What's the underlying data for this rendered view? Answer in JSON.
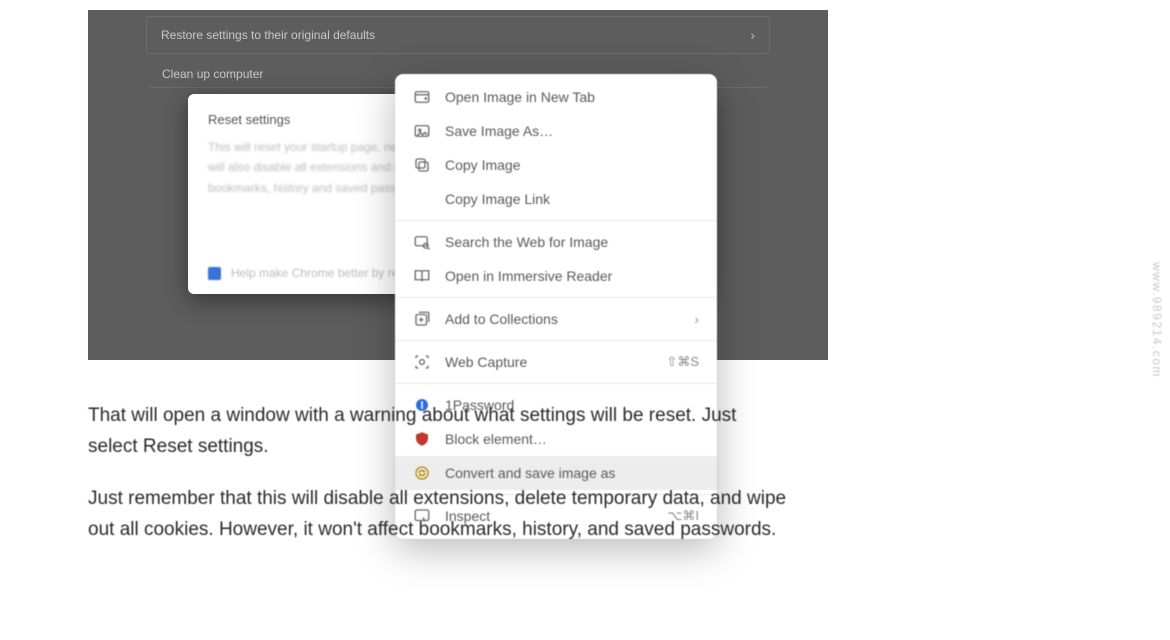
{
  "shot": {
    "row1": "Restore settings to their original defaults",
    "row2": "Clean up computer"
  },
  "dialog": {
    "title": "Reset settings",
    "body_l1": "This will reset your startup page, new tab",
    "body_l2": "will also disable all extensions and clear",
    "body_l3": "bookmarks, history and saved passwords",
    "footer": "Help make Chrome better by report"
  },
  "ctx": {
    "open_new_tab": "Open Image in New Tab",
    "save_as": "Save Image As…",
    "copy_image": "Copy Image",
    "copy_link": "Copy Image Link",
    "search_web": "Search the Web for Image",
    "immersive": "Open in Immersive Reader",
    "collections": "Add to Collections",
    "web_capture": "Web Capture",
    "web_capture_shortcut": "⇧⌘S",
    "onepassword": "1Password",
    "block_element": "Block element…",
    "convert_save": "Convert and save image as",
    "inspect": "Inspect",
    "inspect_shortcut": "⌥⌘I"
  },
  "article": {
    "p1": "That will open a window with a warning about what settings will be reset. Just select Reset settings.",
    "p2": "Just remember that this will disable all extensions, delete temporary data, and wipe out all cookies. However, it won't affect bookmarks, history, and saved passwords."
  },
  "watermark": "www.989214.com"
}
